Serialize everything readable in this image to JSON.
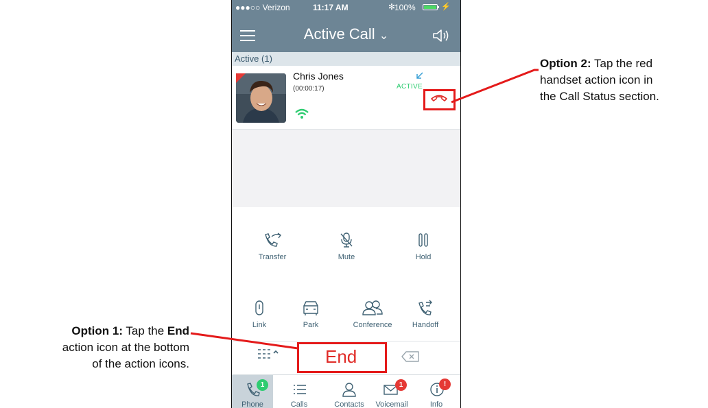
{
  "status_bar": {
    "carrier": "●●●○○ Verizon",
    "time": "11:17 AM",
    "battery": "100%"
  },
  "header": {
    "title": "Active Call",
    "title_chevron": "⌄"
  },
  "active_section": {
    "label": "Active (1)"
  },
  "call": {
    "name": "Chris Jones",
    "duration": "(00:00:17)",
    "state": "ACTIVE"
  },
  "actions": {
    "transfer": "Transfer",
    "mute": "Mute",
    "hold": "Hold",
    "link": "Link",
    "park": "Park",
    "conference": "Conference",
    "handoff": "Handoff",
    "end": "End"
  },
  "tabs": [
    {
      "label": "Phone",
      "badge": "1"
    },
    {
      "label": "Calls"
    },
    {
      "label": "Contacts"
    },
    {
      "label": "Voicemail",
      "badge": "1"
    },
    {
      "label": "Info",
      "badge": "!"
    }
  ],
  "annotations": {
    "option1": {
      "lead": "Option 1:",
      "t1": " Tap the ",
      "bold": "End",
      "t2": "action icon at the bottom",
      "t3": "of the action icons."
    },
    "option2": {
      "lead": "Option 2:",
      "t1": " Tap the red",
      "t2": "handset action icon in",
      "t3": "the Call Status section."
    }
  },
  "colors": {
    "header_bg": "#6d8595",
    "accent_red": "#e02b27",
    "active_green": "#2ecc71",
    "badge_green": "#2ecc71",
    "badge_red": "#e53935",
    "annotation_red": "#e41a1a"
  },
  "icons": {
    "menu": "menu-icon",
    "speaker": "speaker-icon",
    "hangup": "hangup-handset-icon",
    "keypad": "keypad-icon",
    "delete": "backspace-icon"
  }
}
